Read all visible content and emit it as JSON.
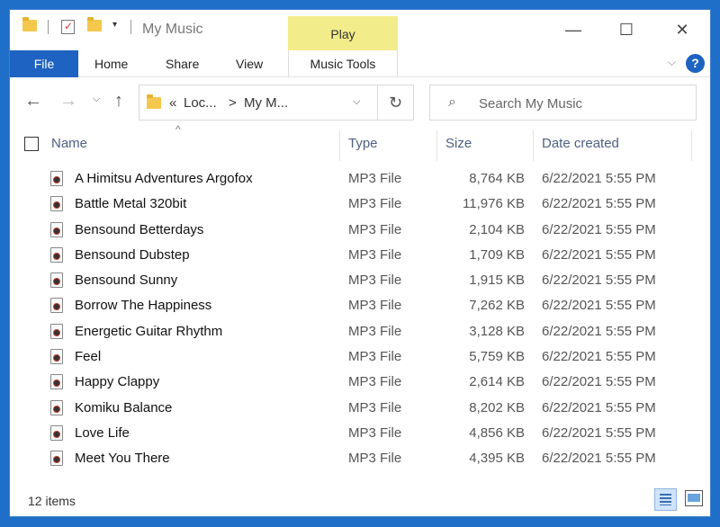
{
  "window": {
    "title": "My Music",
    "contextual_tab": "Play"
  },
  "ribbon": {
    "tabs": [
      "File",
      "Home",
      "Share",
      "View",
      "Music Tools"
    ]
  },
  "address": {
    "prefix": "«",
    "crumb1": "Loc...",
    "sep": ">",
    "crumb2": "My M..."
  },
  "search": {
    "placeholder": "Search My Music"
  },
  "columns": {
    "name": "Name",
    "type": "Type",
    "size": "Size",
    "date": "Date created"
  },
  "files": [
    {
      "name": "A Himitsu Adventures Argofox",
      "type": "MP3 File",
      "size": "8,764 KB",
      "date": "6/22/2021 5:55 PM"
    },
    {
      "name": "Battle Metal 320bit",
      "type": "MP3 File",
      "size": "11,976 KB",
      "date": "6/22/2021 5:55 PM"
    },
    {
      "name": "Bensound Betterdays",
      "type": "MP3 File",
      "size": "2,104 KB",
      "date": "6/22/2021 5:55 PM"
    },
    {
      "name": "Bensound Dubstep",
      "type": "MP3 File",
      "size": "1,709 KB",
      "date": "6/22/2021 5:55 PM"
    },
    {
      "name": "Bensound Sunny",
      "type": "MP3 File",
      "size": "1,915 KB",
      "date": "6/22/2021 5:55 PM"
    },
    {
      "name": "Borrow The Happiness",
      "type": "MP3 File",
      "size": "7,262 KB",
      "date": "6/22/2021 5:55 PM"
    },
    {
      "name": "Energetic Guitar Rhythm",
      "type": "MP3 File",
      "size": "3,128 KB",
      "date": "6/22/2021 5:55 PM"
    },
    {
      "name": "Feel",
      "type": "MP3 File",
      "size": "5,759 KB",
      "date": "6/22/2021 5:55 PM"
    },
    {
      "name": "Happy Clappy",
      "type": "MP3 File",
      "size": "2,614 KB",
      "date": "6/22/2021 5:55 PM"
    },
    {
      "name": "Komiku Balance",
      "type": "MP3 File",
      "size": "8,202 KB",
      "date": "6/22/2021 5:55 PM"
    },
    {
      "name": "Love Life",
      "type": "MP3 File",
      "size": "4,856 KB",
      "date": "6/22/2021 5:55 PM"
    },
    {
      "name": "Meet You There",
      "type": "MP3 File",
      "size": "4,395 KB",
      "date": "6/22/2021 5:55 PM"
    }
  ],
  "status": {
    "count": "12 items"
  },
  "colors": {
    "accent": "#1e62c2",
    "play_tab": "#f3ec8a",
    "desktop": "#1f6fc9"
  }
}
